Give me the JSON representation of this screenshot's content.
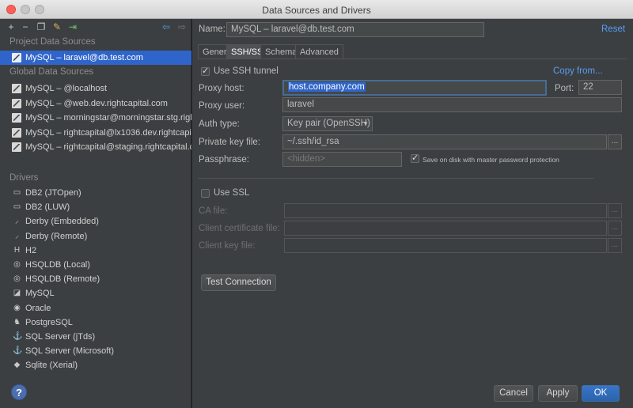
{
  "window": {
    "title": "Data Sources and Drivers"
  },
  "left": {
    "toolbar": [
      "plus-icon",
      "minus-icon",
      "duplicate-icon",
      "properties-icon",
      "export-icon",
      "back-icon",
      "forward-icon"
    ],
    "project_header": "Project Data Sources",
    "project_items": [
      {
        "label": "MySQL – laravel@db.test.com",
        "selected": true
      }
    ],
    "global_header": "Global Data Sources",
    "global_items": [
      {
        "label": "MySQL – @localhost"
      },
      {
        "label": "MySQL – @web.dev.rightcapital.com"
      },
      {
        "label": "MySQL – morningstar@morningstar.stg.righ"
      },
      {
        "label": "MySQL – rightcapital@lx1036.dev.rightcapit"
      },
      {
        "label": "MySQL – rightcapital@staging.rightcapital.c"
      }
    ],
    "drivers_header": "Drivers",
    "drivers": [
      {
        "label": "DB2 (JTOpen)",
        "icon": "ibm-icon",
        "glyph": "▭"
      },
      {
        "label": "DB2 (LUW)",
        "icon": "ibm-icon",
        "glyph": "▭"
      },
      {
        "label": "Derby (Embedded)",
        "icon": "derby-icon",
        "glyph": "⸝"
      },
      {
        "label": "Derby (Remote)",
        "icon": "derby-icon",
        "glyph": "⸝"
      },
      {
        "label": "H2",
        "icon": "h2-icon",
        "glyph": "H"
      },
      {
        "label": "HSQLDB (Local)",
        "icon": "hsqldb-icon",
        "glyph": "◎"
      },
      {
        "label": "HSQLDB (Remote)",
        "icon": "hsqldb-icon",
        "glyph": "◎"
      },
      {
        "label": "MySQL",
        "icon": "mysql-icon",
        "glyph": "◪"
      },
      {
        "label": "Oracle",
        "icon": "oracle-icon",
        "glyph": "◉"
      },
      {
        "label": "PostgreSQL",
        "icon": "postgresql-icon",
        "glyph": "♞"
      },
      {
        "label": "SQL Server (jTds)",
        "icon": "sqlserver-icon",
        "glyph": "⚓"
      },
      {
        "label": "SQL Server (Microsoft)",
        "icon": "sqlserver-icon",
        "glyph": "⚓"
      },
      {
        "label": "Sqlite (Xerial)",
        "icon": "sqlite-icon",
        "glyph": "◆"
      }
    ],
    "help": "?"
  },
  "right": {
    "name_label": "Name:",
    "name_value": "MySQL – laravel@db.test.com",
    "reset": "Reset",
    "tabs": [
      {
        "label": "General",
        "active": false
      },
      {
        "label": "SSH/SSL",
        "active": true
      },
      {
        "label": "Schemas",
        "active": false
      },
      {
        "label": "Advanced",
        "active": false
      }
    ],
    "ssh": {
      "use_tunnel_label": "Use SSH tunnel",
      "use_tunnel_checked": true,
      "copy_from": "Copy from...",
      "proxy_host_label": "Proxy host:",
      "proxy_host_value": "host.company.com",
      "port_label": "Port:",
      "port_value": "22",
      "proxy_user_label": "Proxy user:",
      "proxy_user_value": "laravel",
      "auth_type_label": "Auth type:",
      "auth_type_value": "Key pair (OpenSSH)",
      "key_file_label": "Private key file:",
      "key_file_value": "~/.ssh/id_rsa",
      "passphrase_label": "Passphrase:",
      "passphrase_placeholder": "<hidden>",
      "save_on_disk_label": "Save on disk with master password protection",
      "save_on_disk_checked": true
    },
    "ssl": {
      "use_ssl_label": "Use SSL",
      "use_ssl_checked": false,
      "ca_file_label": "CA file:",
      "client_cert_label": "Client certificate file:",
      "client_key_label": "Client key file:"
    },
    "test_connection": "Test Connection",
    "footer": {
      "cancel": "Cancel",
      "apply": "Apply",
      "ok": "OK"
    }
  },
  "glyphs": {
    "browse": "...",
    "dropdown": "▼"
  }
}
